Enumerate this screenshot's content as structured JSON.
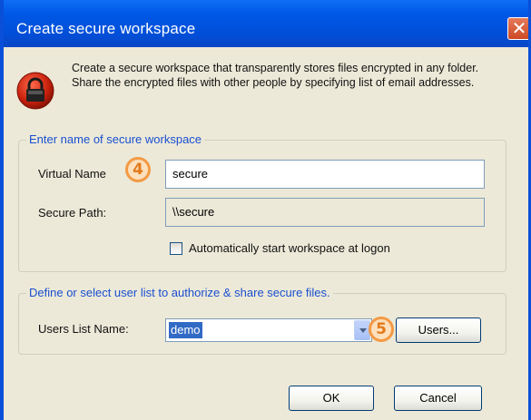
{
  "dialog": {
    "title": "Create secure workspace",
    "close_symbol": "✕",
    "intro_text": "Create a secure workspace that transparently stores files encrypted in any folder. Share the encrypted files with other people by specifying list of email addresses.",
    "icon": "lock-icon"
  },
  "workspace_group": {
    "legend": "Enter name of secure workspace",
    "virtual_name_label": "Virtual Name",
    "virtual_name_value": "secure",
    "secure_path_label": "Secure Path:",
    "secure_path_value": "\\\\secure",
    "autostart_label": "Automatically start workspace at logon",
    "autostart_checked": false
  },
  "users_group": {
    "legend": "Define or select user list to authorize & share secure files.",
    "users_list_label": "Users List Name:",
    "users_list_value": "demo",
    "users_button": "Users..."
  },
  "buttons": {
    "ok": "OK",
    "cancel": "Cancel"
  },
  "callouts": {
    "step4": "4",
    "step5": "5"
  },
  "colors": {
    "titlebar": "#0058e6",
    "legend_text": "#1a4fd0",
    "callout_orange": "#f39a44",
    "selection": "#316ac5"
  }
}
